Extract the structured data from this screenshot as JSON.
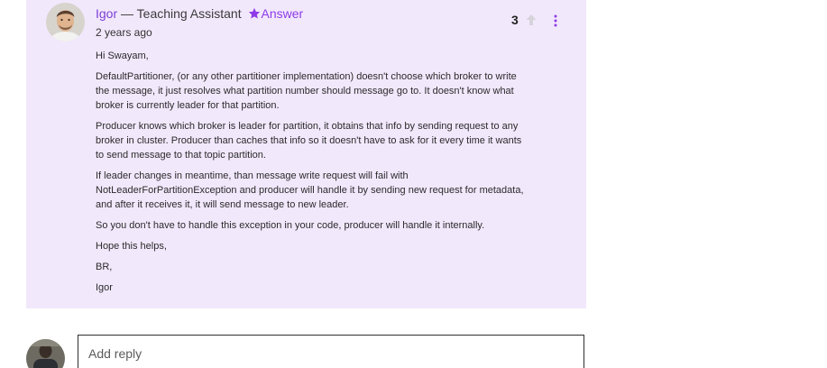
{
  "answer": {
    "author": {
      "name": "Igor",
      "role_separator": " — Teaching Assistant ",
      "badge_label": "Answer"
    },
    "timestamp": "2 years ago",
    "votes": "3",
    "paragraphs": [
      "Hi Swayam,",
      "DefaultPartitioner, (or any other partitioner implementation) doesn't choose which broker to write\nthe message, it just resolves what partition number should message go to. It doesn't know what\nbroker is currently leader for that partition.",
      "Producer knows which broker is leader for partition, it obtains that info by sending request to any\nbroker in cluster. Producer than caches that info  so it doesn't have to ask for it every time it wants\nto  send message to that topic partition.",
      "If leader changes in meantime, than message write request will fail with\nNotLeaderForPartitionException and producer will handle it by sending new request for metadata,\nand after it receives it, it will send message to new leader.",
      "So you don't have to handle this exception in your code, producer will handle it internally.",
      "Hope this  helps,",
      "BR,",
      "Igor"
    ]
  },
  "reply": {
    "placeholder": "Add reply"
  },
  "colors": {
    "card_background": "#f2e8fc",
    "accent": "#8d3be8",
    "author_name": "#7c3fd3"
  },
  "icons": {
    "star": "star-icon",
    "upvote": "arrow-up-icon",
    "more": "more-vertical-icon"
  }
}
